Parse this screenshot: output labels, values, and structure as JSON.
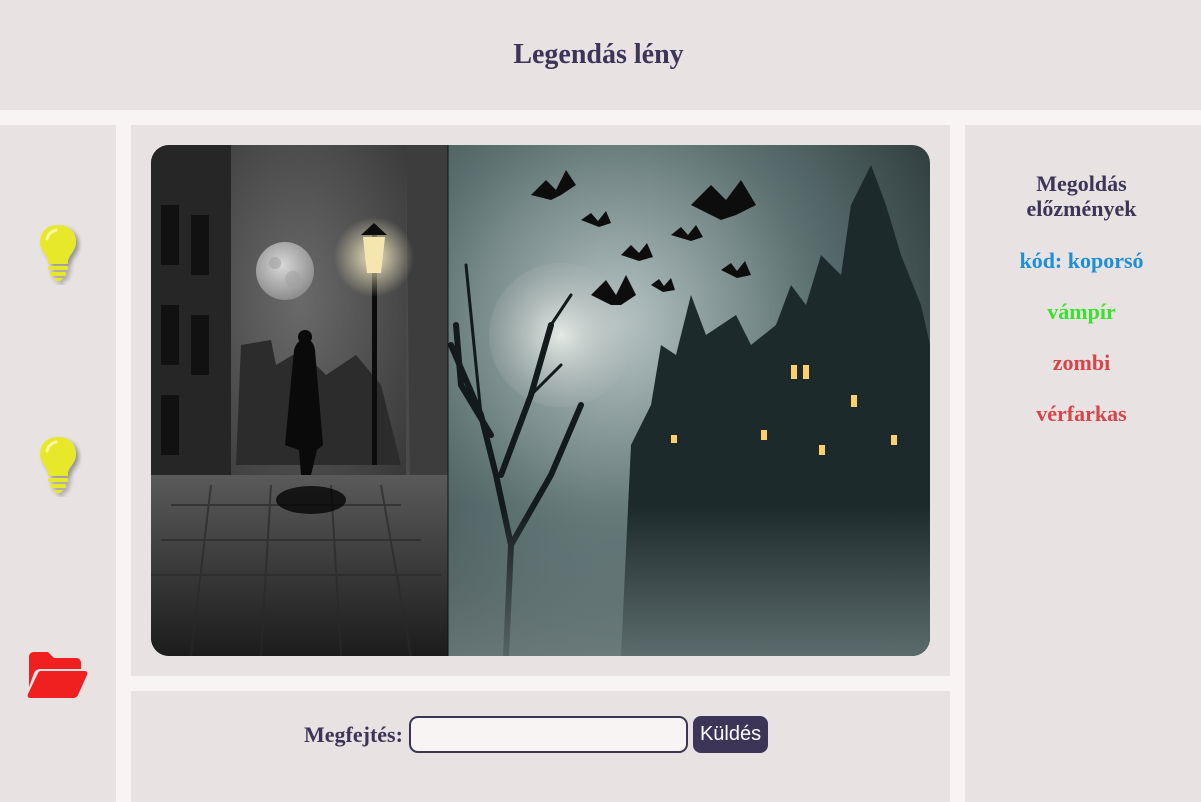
{
  "page": {
    "title": "Legendás lény"
  },
  "sidebar": {
    "hint1_icon": "lightbulb-icon",
    "hint2_icon": "lightbulb-icon",
    "folder_icon": "folder-open-icon",
    "hint_color": "#e8e82a",
    "folder_color": "#f02020"
  },
  "image": {
    "alt": "Vámpír a ködös utcán és egy kísértetkastély denevérekkel"
  },
  "answer": {
    "label": "Megfejtés:",
    "value": "",
    "placeholder": "",
    "submit_label": "Küldés"
  },
  "history": {
    "title_line1": "Megoldás",
    "title_line2": "előzmények",
    "items": [
      {
        "text": "kód: koporsó",
        "color": "#1e8fd6"
      },
      {
        "text": "vámpír",
        "color": "#39e22c"
      },
      {
        "text": "zombi",
        "color": "#d9434a"
      },
      {
        "text": "vérfarkas",
        "color": "#d9434a"
      }
    ]
  }
}
